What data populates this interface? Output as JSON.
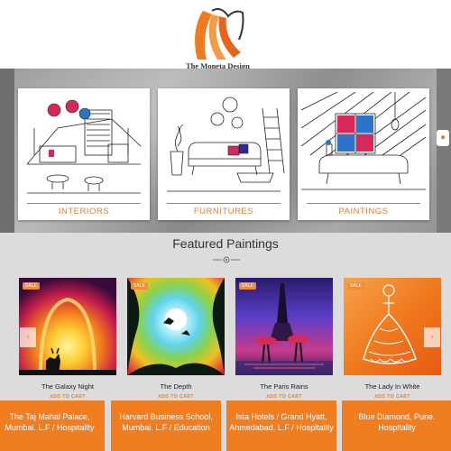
{
  "brand": {
    "name": "The Moneta Design",
    "accent": "#e67c2a"
  },
  "categories": [
    {
      "label": "INTERIORS"
    },
    {
      "label": "FURNITURES"
    },
    {
      "label": "PAINTINGS"
    }
  ],
  "featured": {
    "title": "Featured Paintings",
    "products": [
      {
        "name": "The Galaxy Night",
        "badge": "SALE",
        "cta": "ADD TO CART"
      },
      {
        "name": "The Depth",
        "badge": "SALE",
        "cta": "ADD TO CART"
      },
      {
        "name": "The Paris Rains",
        "badge": "SALE",
        "cta": "ADD TO CART"
      },
      {
        "name": "The Lady In White",
        "badge": "SALE",
        "cta": "ADD TO CART"
      }
    ],
    "prev_icon": "chevron-left-icon",
    "next_icon": "chevron-right-icon"
  },
  "projects": [
    {
      "text": "The Taj Mahal Palace, Mumbai. L.F / Hospitality"
    },
    {
      "text": "Harvard Business School, Mumbai. L.F / Education"
    },
    {
      "text": "Ista Hotels / Grand Hyatt, Ahmedabad. L.F / Hospitality"
    },
    {
      "text": "Blue Diamond, Pune. Hospitality"
    }
  ]
}
